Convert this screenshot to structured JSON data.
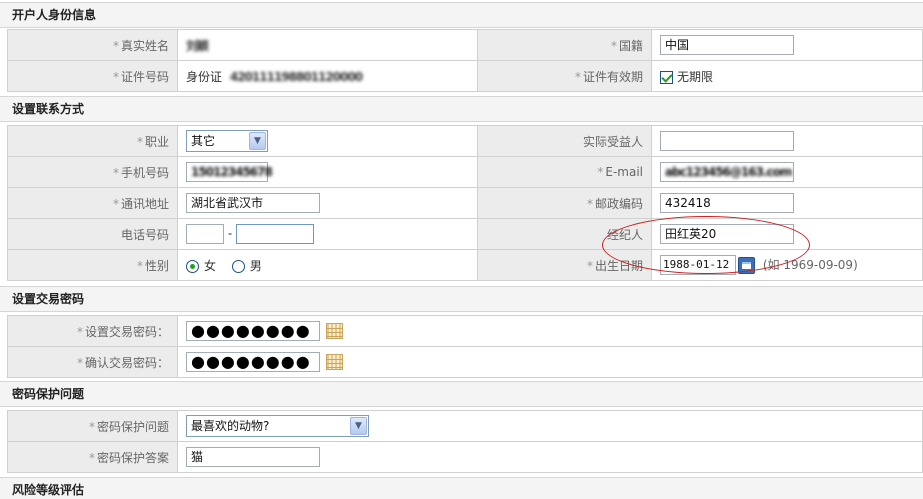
{
  "sections": {
    "account_holder": "开户人身份信息",
    "contact": "设置联系方式",
    "trade_password": "设置交易密码",
    "password_protection": "密码保护问题",
    "risk_assessment": "风险等级评估"
  },
  "required_mark": "*",
  "identity": {
    "real_name_label": "真实姓名",
    "real_name_value": "刘颖",
    "nationality_label": "国籍",
    "nationality_value": "中国",
    "id_number_label": "证件号码",
    "id_type": "身份证",
    "id_number_value": "420111198801120000",
    "id_validity_label": "证件有效期",
    "id_validity_value": "无期限"
  },
  "contact": {
    "occupation_label": "职业",
    "occupation_value": "其它",
    "beneficiary_label": "实际受益人",
    "beneficiary_value": "",
    "mobile_label": "手机号码",
    "mobile_value": "15012345678",
    "email_label": "E-mail",
    "email_value": "abc123456@163.com",
    "address_label": "通讯地址",
    "address_value": "湖北省武汉市",
    "postcode_label": "邮政编码",
    "postcode_value": "432418",
    "phone_label": "电话号码",
    "phone_separator": "-",
    "broker_label": "经纪人",
    "broker_value": "田红英20",
    "gender_label": "性别",
    "gender_female": "女",
    "gender_male": "男",
    "birthdate_label": "出生日期",
    "birthdate_value": "1988-01-12",
    "birthdate_hint": "(如 1969-09-09)"
  },
  "trade_password": {
    "set_label": "设置交易密码：",
    "set_value": "●●●●●●●●",
    "confirm_label": "确认交易密码：",
    "confirm_value": "●●●●●●●●"
  },
  "protection": {
    "question_label": "密码保护问题",
    "question_value": "最喜欢的动物?",
    "answer_label": "密码保护答案",
    "answer_value": "猫"
  },
  "colors": {
    "annotation": "#cc1f1f",
    "check_green": "#21a121",
    "label_bg": "#ececec"
  }
}
